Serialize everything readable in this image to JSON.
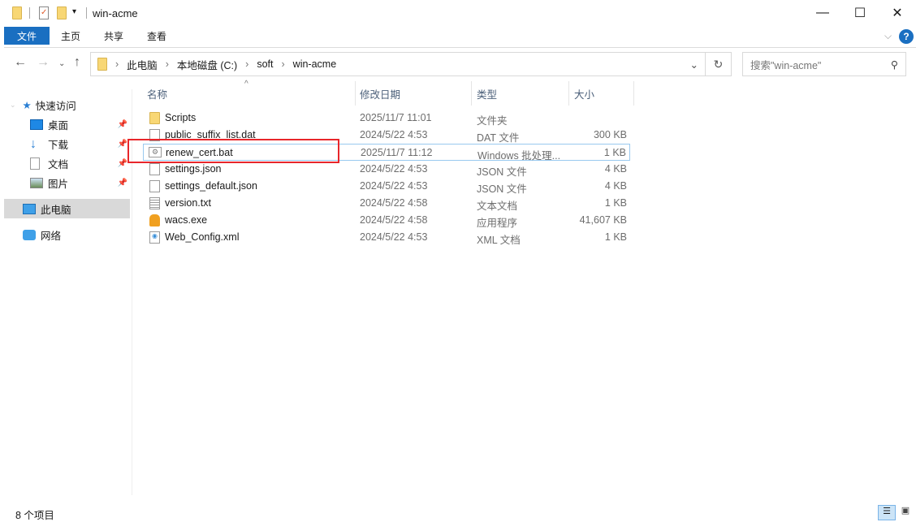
{
  "window": {
    "title": "win-acme",
    "minimize": "—",
    "maximize": "☐",
    "close": "✕"
  },
  "ribbon": {
    "tabs": [
      "文件",
      "主页",
      "共享",
      "查看"
    ],
    "expand": "⌵",
    "help": "?"
  },
  "address": {
    "crumbs": [
      "此电脑",
      "本地磁盘 (C:)",
      "soft",
      "win-acme"
    ],
    "refresh": "↻",
    "search_placeholder": "搜索\"win-acme\""
  },
  "nav": {
    "quick_access": "快速访问",
    "items": [
      "桌面",
      "下载",
      "文档",
      "图片"
    ],
    "this_pc": "此电脑",
    "network": "网络"
  },
  "columns": {
    "name": "名称",
    "date": "修改日期",
    "type": "类型",
    "size": "大小"
  },
  "files": [
    {
      "name": "Scripts",
      "date": "2025/11/7 11:01",
      "type": "文件夹",
      "size": "",
      "icon": "folder"
    },
    {
      "name": "public_suffix_list.dat",
      "date": "2024/5/22 4:53",
      "type": "DAT 文件",
      "size": "300 KB",
      "icon": "file"
    },
    {
      "name": "renew_cert.bat",
      "date": "2025/11/7 11:12",
      "type": "Windows 批处理...",
      "size": "1 KB",
      "icon": "batch"
    },
    {
      "name": "settings.json",
      "date": "2024/5/22 4:53",
      "type": "JSON 文件",
      "size": "4 KB",
      "icon": "file"
    },
    {
      "name": "settings_default.json",
      "date": "2024/5/22 4:53",
      "type": "JSON 文件",
      "size": "4 KB",
      "icon": "file"
    },
    {
      "name": "version.txt",
      "date": "2024/5/22 4:58",
      "type": "文本文档",
      "size": "1 KB",
      "icon": "text"
    },
    {
      "name": "wacs.exe",
      "date": "2024/5/22 4:58",
      "type": "应用程序",
      "size": "41,607 KB",
      "icon": "exe"
    },
    {
      "name": "Web_Config.xml",
      "date": "2024/5/22 4:53",
      "type": "XML 文档",
      "size": "1 KB",
      "icon": "xml"
    }
  ],
  "status": {
    "count": "8 个项目"
  },
  "colors": {
    "accent": "#1a6fc1",
    "highlight": "#e8262b"
  }
}
